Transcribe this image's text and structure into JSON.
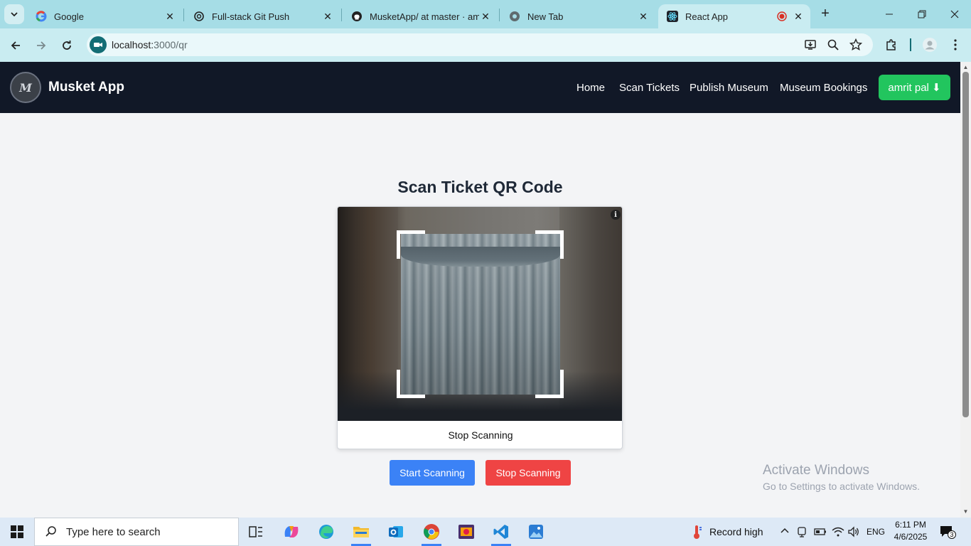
{
  "browser": {
    "tabs": [
      {
        "title": "Google",
        "icon": "google-icon"
      },
      {
        "title": "Full-stack Git Push",
        "icon": "openai-icon"
      },
      {
        "title": "MusketApp/ at master · amri",
        "icon": "github-icon"
      },
      {
        "title": "New Tab",
        "icon": "chrome-icon"
      },
      {
        "title": "React App",
        "icon": "react-icon",
        "active": true
      }
    ],
    "url_host": "localhost:",
    "url_path": "3000/qr"
  },
  "app": {
    "brand": "Musket App",
    "logo_text": "M",
    "nav": [
      "Home",
      "Scan Tickets",
      "Publish Museum",
      "Museum Bookings"
    ],
    "user_button": "amrit pal ⬇"
  },
  "main": {
    "title": "Scan Ticket QR Code",
    "scanner_stop_label": "Stop Scanning",
    "start_button": "Start Scanning",
    "stop_button": "Stop Scanning"
  },
  "watermark": {
    "line1": "Activate Windows",
    "line2": "Go to Settings to activate Windows."
  },
  "taskbar": {
    "search_placeholder": "Type here to search",
    "weather": "Record high",
    "language": "ENG",
    "time": "6:11 PM",
    "date": "4/6/2025",
    "notifications": "3"
  },
  "colors": {
    "navbar": "#111827",
    "user_button": "#22c55e",
    "start_button": "#3b82f6",
    "stop_button": "#ef4444"
  }
}
